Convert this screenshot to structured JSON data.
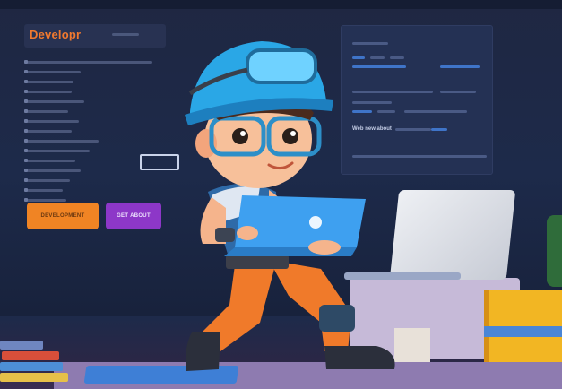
{
  "screen": {
    "brand": "Developr",
    "buttons": [
      "DEVELOPMENT",
      "GET ABOUT"
    ],
    "panel_heading": "Web new about"
  },
  "colors": {
    "background": "#1b2440",
    "brand_orange": "#f0792f",
    "button_orange": "#f08424",
    "button_purple": "#8d37c8",
    "laptop_blue": "#3ea0f0",
    "helmet_blue": "#2aa7e6",
    "pants_orange": "#f07a2a"
  },
  "icons": {
    "laptop_logo": "apple-logo-icon"
  }
}
